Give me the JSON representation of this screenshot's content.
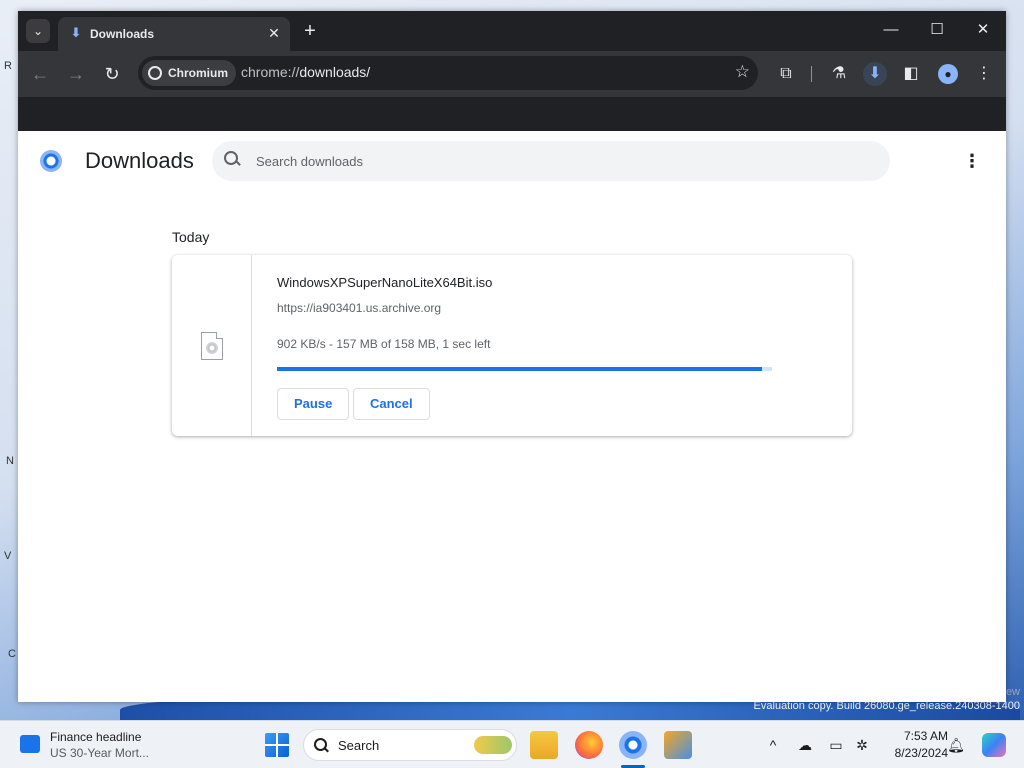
{
  "browser": {
    "tab_title": "Downloads",
    "chip_label": "Chromium",
    "url_scheme": "chrome://",
    "url_path": "downloads/"
  },
  "downloads_page": {
    "title": "Downloads",
    "search_placeholder": "Search downloads",
    "section_label": "Today",
    "item": {
      "filename": "WindowsXPSuperNanoLiteX64Bit.iso",
      "source_url": "https://ia903401.us.archive.org",
      "status": "902 KB/s - 157 MB of 158 MB, 1 sec left",
      "progress_fraction": 0.98,
      "pause_label": "Pause",
      "cancel_label": "Cancel"
    }
  },
  "desktop": {
    "watermark": "Evaluation copy. Build 26080.ge_release.240308-1400",
    "watermark_fragment": "ew"
  },
  "taskbar": {
    "widget_title": "Finance headline",
    "widget_subtitle": "US 30-Year Mort...",
    "search_label": "Search",
    "time": "7:53 AM",
    "date": "8/23/2024"
  }
}
